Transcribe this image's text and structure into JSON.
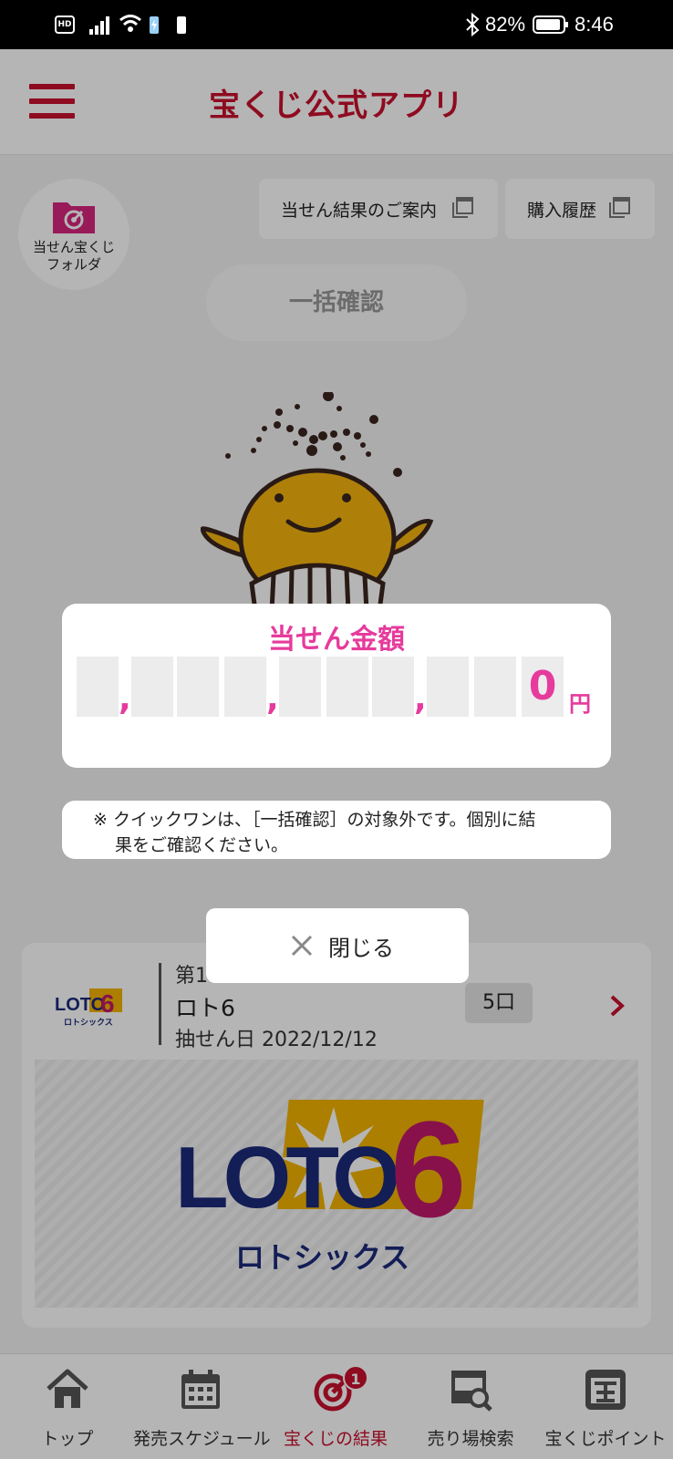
{
  "status_bar": {
    "hd_label": "HD",
    "battery_percent": "82%",
    "time": "8:46"
  },
  "header": {
    "title": "宝くじ公式アプリ"
  },
  "toolbar": {
    "folder_label_1": "当せん宝くじ",
    "folder_label_2": "フォルダ",
    "notice_label": "当せん結果のご案内",
    "history_label": "購入履歴",
    "bulk_check_label": "一括確認"
  },
  "ticket_card": {
    "draw_number": "第1",
    "name": "ロト6",
    "draw_date_label": "抽せん日",
    "draw_date": "2022/12/12",
    "units": "5口",
    "small_logo_text": "LOTO",
    "small_logo_digit": "6",
    "small_logo_sub": "ロトシックス",
    "banner_logo_text": "LOTO",
    "banner_logo_digit": "6",
    "banner_logo_sub": "ロトシックス"
  },
  "prize_modal": {
    "title": "当せん金額",
    "digits": [
      "",
      "",
      "",
      "",
      "",
      "",
      "",
      "",
      "",
      "0"
    ],
    "separator": ",",
    "currency": "円"
  },
  "note": {
    "line1": "※ クイックワンは、［一括確認］の対象外です。個別に結",
    "line2": "果をご確認ください。"
  },
  "close_button": {
    "label": "閉じる"
  },
  "bottom_nav": {
    "items": [
      {
        "label": "トップ",
        "icon": "home-icon",
        "active": false
      },
      {
        "label": "発売スケジュール",
        "icon": "calendar-icon",
        "active": false
      },
      {
        "label": "宝くじの結果",
        "icon": "target-icon",
        "active": true,
        "badge": "1"
      },
      {
        "label": "売り場検索",
        "icon": "store-search-icon",
        "active": false
      },
      {
        "label": "宝くじポイント",
        "icon": "points-icon",
        "active": false
      }
    ]
  },
  "colors": {
    "brand_red": "#c8102e",
    "prize_pink": "#e63b9c",
    "mascot_yellow": "#f5b50f"
  }
}
